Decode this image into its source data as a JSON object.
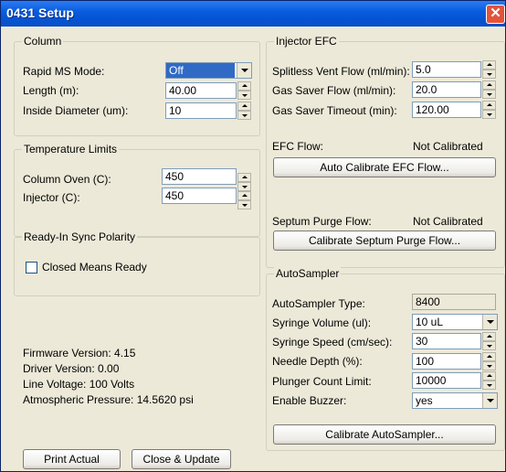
{
  "window": {
    "title": "0431 Setup",
    "close_glyph": "✕"
  },
  "column": {
    "legend": "Column",
    "rapid_ms_mode": {
      "label": "Rapid MS Mode:",
      "value": "Off"
    },
    "length": {
      "label": "Length (m):",
      "value": "40.00"
    },
    "inside_diameter": {
      "label": "Inside Diameter (um):",
      "value": "10"
    }
  },
  "temperature_limits": {
    "legend": "Temperature Limits",
    "column_oven": {
      "label": "Column Oven (C):",
      "value": "450"
    },
    "injector": {
      "label": "Injector (C):",
      "value": "450"
    }
  },
  "ready_in": {
    "legend": "Ready-In Sync Polarity",
    "closed_means_ready": {
      "label": "Closed Means Ready",
      "checked": false
    }
  },
  "info": {
    "firmware": "Firmware Version: 4.15",
    "driver": "Driver Version: 0.00",
    "line_voltage": "Line Voltage: 100 Volts",
    "pressure": "Atmospheric Pressure: 14.5620 psi"
  },
  "buttons": {
    "print_actual": "Print Actual",
    "close_update": "Close & Update"
  },
  "injector_efc": {
    "legend": "Injector EFC",
    "splitless_vent_flow": {
      "label": "Splitless Vent Flow (ml/min):",
      "value": "5.0"
    },
    "gas_saver_flow": {
      "label": "Gas Saver Flow (ml/min):",
      "value": "20.0"
    },
    "gas_saver_timeout": {
      "label": "Gas Saver Timeout (min):",
      "value": "120.00"
    },
    "efc_flow": {
      "label": "EFC Flow:",
      "status": "Not Calibrated"
    },
    "auto_calibrate_button": "Auto Calibrate EFC Flow...",
    "septum_purge_flow": {
      "label": "Septum Purge Flow:",
      "status": "Not Calibrated"
    },
    "calibrate_septum_button": "Calibrate Septum Purge Flow..."
  },
  "autosampler": {
    "legend": "AutoSampler",
    "type": {
      "label": "AutoSampler Type:",
      "value": "8400"
    },
    "syringe_volume": {
      "label": "Syringe Volume (ul):",
      "value": "10 uL"
    },
    "syringe_speed": {
      "label": "Syringe Speed (cm/sec):",
      "value": "30"
    },
    "needle_depth": {
      "label": "Needle Depth (%):",
      "value": "100"
    },
    "plunger_count_limit": {
      "label": "Plunger Count Limit:",
      "value": "10000"
    },
    "enable_buzzer": {
      "label": "Enable Buzzer:",
      "value": "yes"
    },
    "calibrate_button": "Calibrate AutoSampler..."
  }
}
